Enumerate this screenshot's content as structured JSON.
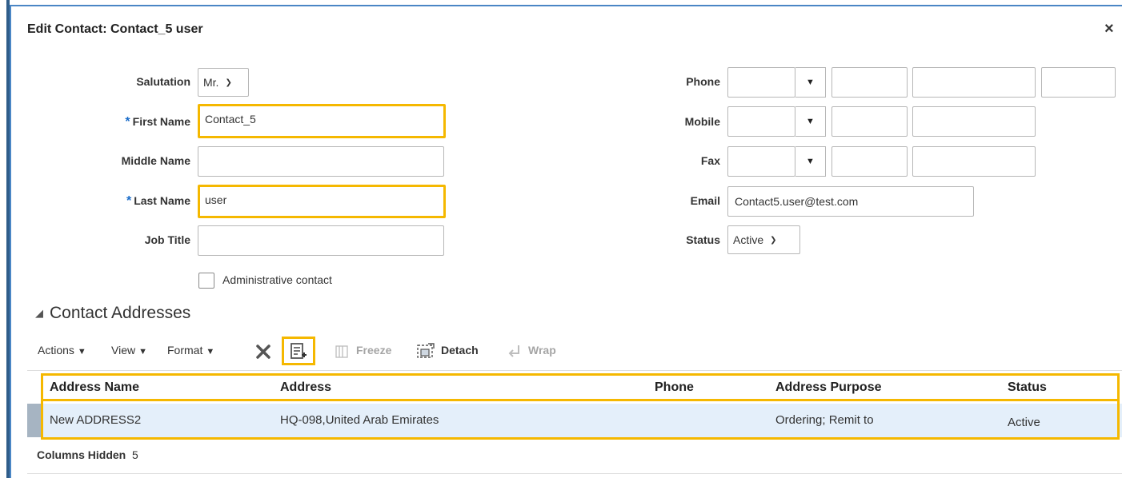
{
  "dialog": {
    "title": "Edit Contact: Contact_5 user",
    "close_glyph": "×"
  },
  "form_left": {
    "salutation": {
      "label": "Salutation",
      "value": "Mr."
    },
    "first_name": {
      "required_mark": "*",
      "label": "First Name",
      "value": "Contact_5"
    },
    "middle_name": {
      "label": "Middle Name",
      "value": ""
    },
    "last_name": {
      "required_mark": "*",
      "label": "Last Name",
      "value": "user"
    },
    "job_title": {
      "label": "Job Title",
      "value": ""
    },
    "admin_contact": {
      "label": "Administrative contact",
      "checked": false
    }
  },
  "form_right": {
    "phone": {
      "label": "Phone"
    },
    "mobile": {
      "label": "Mobile"
    },
    "fax": {
      "label": "Fax"
    },
    "email": {
      "label": "Email",
      "value": "Contact5.user@test.com"
    },
    "status": {
      "label": "Status",
      "value": "Active"
    }
  },
  "section": {
    "title": "Contact Addresses"
  },
  "toolbar": {
    "actions": "Actions",
    "view": "View",
    "format": "Format",
    "freeze": "Freeze",
    "detach": "Detach",
    "wrap": "Wrap"
  },
  "table": {
    "headers": [
      "Address Name",
      "Address",
      "Phone",
      "Address Purpose",
      "Status"
    ],
    "rows": [
      [
        "New ADDRESS2",
        "HQ-098,United Arab Emirates",
        "",
        "Ordering; Remit to",
        "Active"
      ]
    ],
    "columns_hidden_label": "Columns Hidden",
    "columns_hidden_count": "5"
  },
  "colors": {
    "highlight": "#f5b800",
    "required": "#1a6cc9",
    "row_selected": "#e4effa"
  }
}
